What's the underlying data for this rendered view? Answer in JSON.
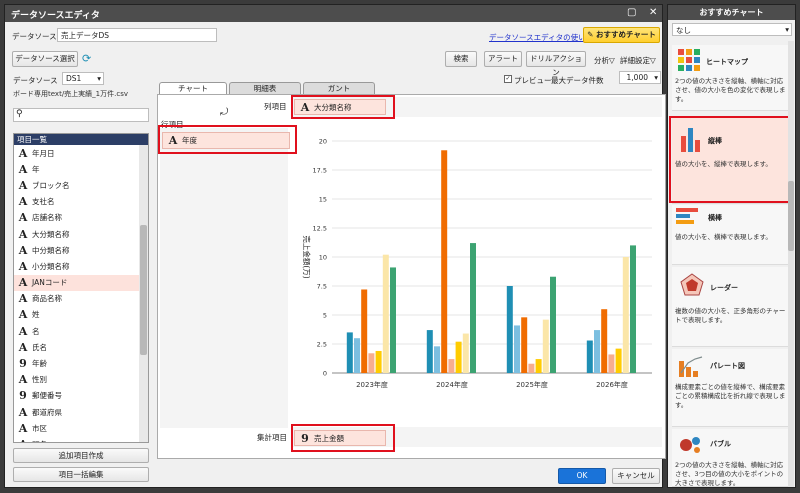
{
  "window": {
    "title": "データソースエディタ"
  },
  "header": {
    "ds_name_label": "データソース名",
    "ds_name_value": "売上データDS",
    "help_link": "データソースエディタの使い方",
    "recommend_btn": "おすすめチャート",
    "select_ds_btn": "データソース選択"
  },
  "toolbar": {
    "search": "検索",
    "alert": "アラート",
    "drill": "ドリルアクション",
    "analysis": "分析▽",
    "detail": "詳細設定▽",
    "preview_label": "プレビュー",
    "maxrows_label": "最大データ件数",
    "maxrows_value": "1,000"
  },
  "left": {
    "ds_label": "データソース",
    "ds_value": "DS1",
    "file_path": "ボード専用text/売上実績_1万件.csv",
    "list_header": "項目一覧",
    "items": [
      {
        "icon": "A",
        "name": "年月日"
      },
      {
        "icon": "A",
        "name": "年"
      },
      {
        "icon": "A",
        "name": "ブロック名"
      },
      {
        "icon": "A",
        "name": "支社名"
      },
      {
        "icon": "A",
        "name": "店舗名称"
      },
      {
        "icon": "A",
        "name": "大分類名称"
      },
      {
        "icon": "A",
        "name": "中分類名称"
      },
      {
        "icon": "A",
        "name": "小分類名称"
      },
      {
        "icon": "A",
        "name": "JANコード"
      },
      {
        "icon": "A",
        "name": "商品名称"
      },
      {
        "icon": "A",
        "name": "姓"
      },
      {
        "icon": "A",
        "name": "名"
      },
      {
        "icon": "A",
        "name": "氏名"
      },
      {
        "icon": "9",
        "name": "年齢"
      },
      {
        "icon": "A",
        "name": "性別"
      },
      {
        "icon": "9",
        "name": "郵便番号"
      },
      {
        "icon": "A",
        "name": "都道府県"
      },
      {
        "icon": "A",
        "name": "市区"
      },
      {
        "icon": "A",
        "name": "町名"
      }
    ],
    "add_btn": "追加項目作成",
    "bulk_btn": "項目一括編集"
  },
  "tabs": [
    "チャート",
    "明細表",
    "ガント"
  ],
  "zones": {
    "col_label": "列項目",
    "col_item": "大分類名称",
    "row_label": "行項目",
    "row_item": "年度",
    "agg_label": "集計項目",
    "agg_item": "売上金額"
  },
  "footer": {
    "ok": "OK",
    "cancel": "キャンセル"
  },
  "right_panel": {
    "title": "おすすめチャート",
    "filter": "なし",
    "cards": [
      {
        "name": "ヒートマップ",
        "desc": "2つの値の大きさを縦軸、横軸に対応させ、値の大小を色の変化で表現します。"
      },
      {
        "name": "縦棒",
        "desc": "値の大小を、縦棒で表現します。"
      },
      {
        "name": "横棒",
        "desc": "値の大小を、横棒で表現します。"
      },
      {
        "name": "レーダー",
        "desc": "複数の値の大小を、正多角形のチャートで表現します。"
      },
      {
        "name": "パレート図",
        "desc": "構成要素ごとの値を縦棒で、構成要素ごとの累積構成比を折れ線で表現します。"
      },
      {
        "name": "バブル",
        "desc": "2つの値の大きさを縦軸、横軸に対応させ、3つ目の値の大小をポイントの大きさで表現します。"
      }
    ]
  },
  "chart_data": {
    "type": "bar",
    "ylabel": "売上金額(万)",
    "ylim": [
      0,
      20
    ],
    "yticks": [
      "0",
      "2.5",
      "5",
      "7.5",
      "10",
      "12.5",
      "15",
      "17.5",
      "20"
    ],
    "categories": [
      "2023年度",
      "2024年度",
      "2025年度",
      "2026年度"
    ],
    "series": [
      {
        "color": "#1f8fb4",
        "values": [
          3.5,
          3.7,
          7.5,
          2.8
        ]
      },
      {
        "color": "#7cbfe0",
        "values": [
          3.0,
          2.3,
          4.1,
          3.7
        ]
      },
      {
        "color": "#f06c00",
        "values": [
          7.2,
          19.2,
          4.8,
          5.5
        ]
      },
      {
        "color": "#f7ad8f",
        "values": [
          1.7,
          1.2,
          0.8,
          1.6
        ]
      },
      {
        "color": "#ffcc00",
        "values": [
          1.9,
          2.7,
          1.2,
          2.1
        ]
      },
      {
        "color": "#fbe6a8",
        "values": [
          10.2,
          3.4,
          4.6,
          10.0
        ]
      },
      {
        "color": "#3ca372",
        "values": [
          9.1,
          11.2,
          8.3,
          11.0
        ]
      }
    ]
  }
}
